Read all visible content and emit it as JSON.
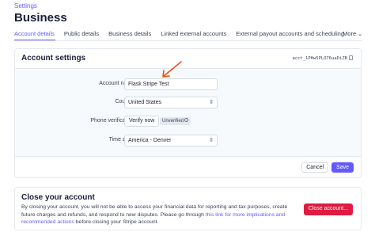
{
  "breadcrumb": "Settings",
  "page_title": "Business",
  "tabs": [
    {
      "label": "Account details",
      "active": true
    },
    {
      "label": "Public details",
      "active": false
    },
    {
      "label": "Business details",
      "active": false
    },
    {
      "label": "Linked external accounts",
      "active": false
    },
    {
      "label": "External payout accounts and scheduling",
      "active": false
    }
  ],
  "more_tab": {
    "label": "More",
    "icon": "chevron-down-icon"
  },
  "account_settings": {
    "title": "Account settings",
    "account_id": "acct_1PHw5PLO76uaDiZB",
    "copy_icon": "copy-icon",
    "fields": {
      "account_name": {
        "label": "Account name",
        "value": "Flask Stripe Test"
      },
      "country": {
        "label": "Country",
        "value": "United States",
        "icon": "select-chevron-icon"
      },
      "phone_verification": {
        "label": "Phone verification",
        "button": "Verify now",
        "badge": "Unverified",
        "badge_icon": "info-icon"
      },
      "time_zone": {
        "label": "Time zone",
        "value": "America - Denver",
        "icon": "select-chevron-icon"
      }
    },
    "annotation": {
      "icon": "arrow-icon",
      "color": "#e8511c"
    },
    "cancel_label": "Cancel",
    "save_label": "Save"
  },
  "close_account": {
    "title": "Close your account",
    "text_before": "By closing your account, you will not be able to access your financial data for reporting and tax purposes, create future charges and refunds, and respond to new disputes. Please go through ",
    "link_text": "this link for more implications and recommended actions",
    "text_after": " before closing your Stripe account.",
    "button_label": "Close account..."
  },
  "colors": {
    "accent": "#635bff",
    "danger": "#df1b41",
    "annotation": "#e8511c"
  }
}
